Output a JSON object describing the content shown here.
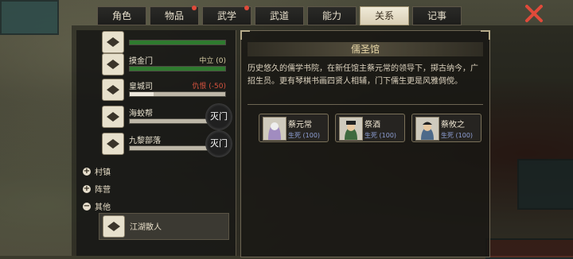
{
  "tabs": [
    {
      "label": "角色",
      "active": false,
      "notify": false
    },
    {
      "label": "物品",
      "active": false,
      "notify": true
    },
    {
      "label": "武学",
      "active": false,
      "notify": true
    },
    {
      "label": "武道",
      "active": false,
      "notify": false
    },
    {
      "label": "能力",
      "active": false,
      "notify": false
    },
    {
      "label": "关系",
      "active": true,
      "notify": false
    },
    {
      "label": "记事",
      "active": false,
      "notify": false
    }
  ],
  "factions": [
    {
      "name": "",
      "status": "",
      "fill": 0.8,
      "bar_color": "#2f7a2f",
      "stamp": ""
    },
    {
      "name": "摸金门",
      "status": "中立 (0)",
      "fill": 1.0,
      "bar_color": "#2f7a2f",
      "stamp": "",
      "status_type": "neutral"
    },
    {
      "name": "皇城司",
      "status": "仇恨 (-50)",
      "fill": 0.25,
      "bar_color": "#d8d2c4",
      "stamp": "",
      "status_type": "hate"
    },
    {
      "name": "海蛟帮",
      "status": "",
      "fill": 0.0,
      "bar_color": "#d8d2c4",
      "stamp": "灭门"
    },
    {
      "name": "九黎部落",
      "status": "",
      "fill": 0.0,
      "bar_color": "#d8d2c4",
      "stamp": "灭门"
    }
  ],
  "groups": {
    "village": "村镇",
    "camp": "阵营",
    "other": "其他"
  },
  "selected_item": "江湖散人",
  "detail": {
    "title": "儒圣馆",
    "description": "历史悠久的儒学书院，在新任馆主蔡元常的领导下，掷古纳今，广招生员。更有琴棋书画四贤人相辅，门下儒生更是风雅倜傥。",
    "people": [
      {
        "name": "蔡元常",
        "relation": "生死 (100)"
      },
      {
        "name": "祭酒",
        "relation": "生死 (100)"
      },
      {
        "name": "蔡攸之",
        "relation": "生死 (100)"
      }
    ]
  },
  "colors": {
    "accent": "#e9d8a8",
    "hate": "#d8533f",
    "relation": "#8fa0d6",
    "close": "#e04a3a"
  }
}
